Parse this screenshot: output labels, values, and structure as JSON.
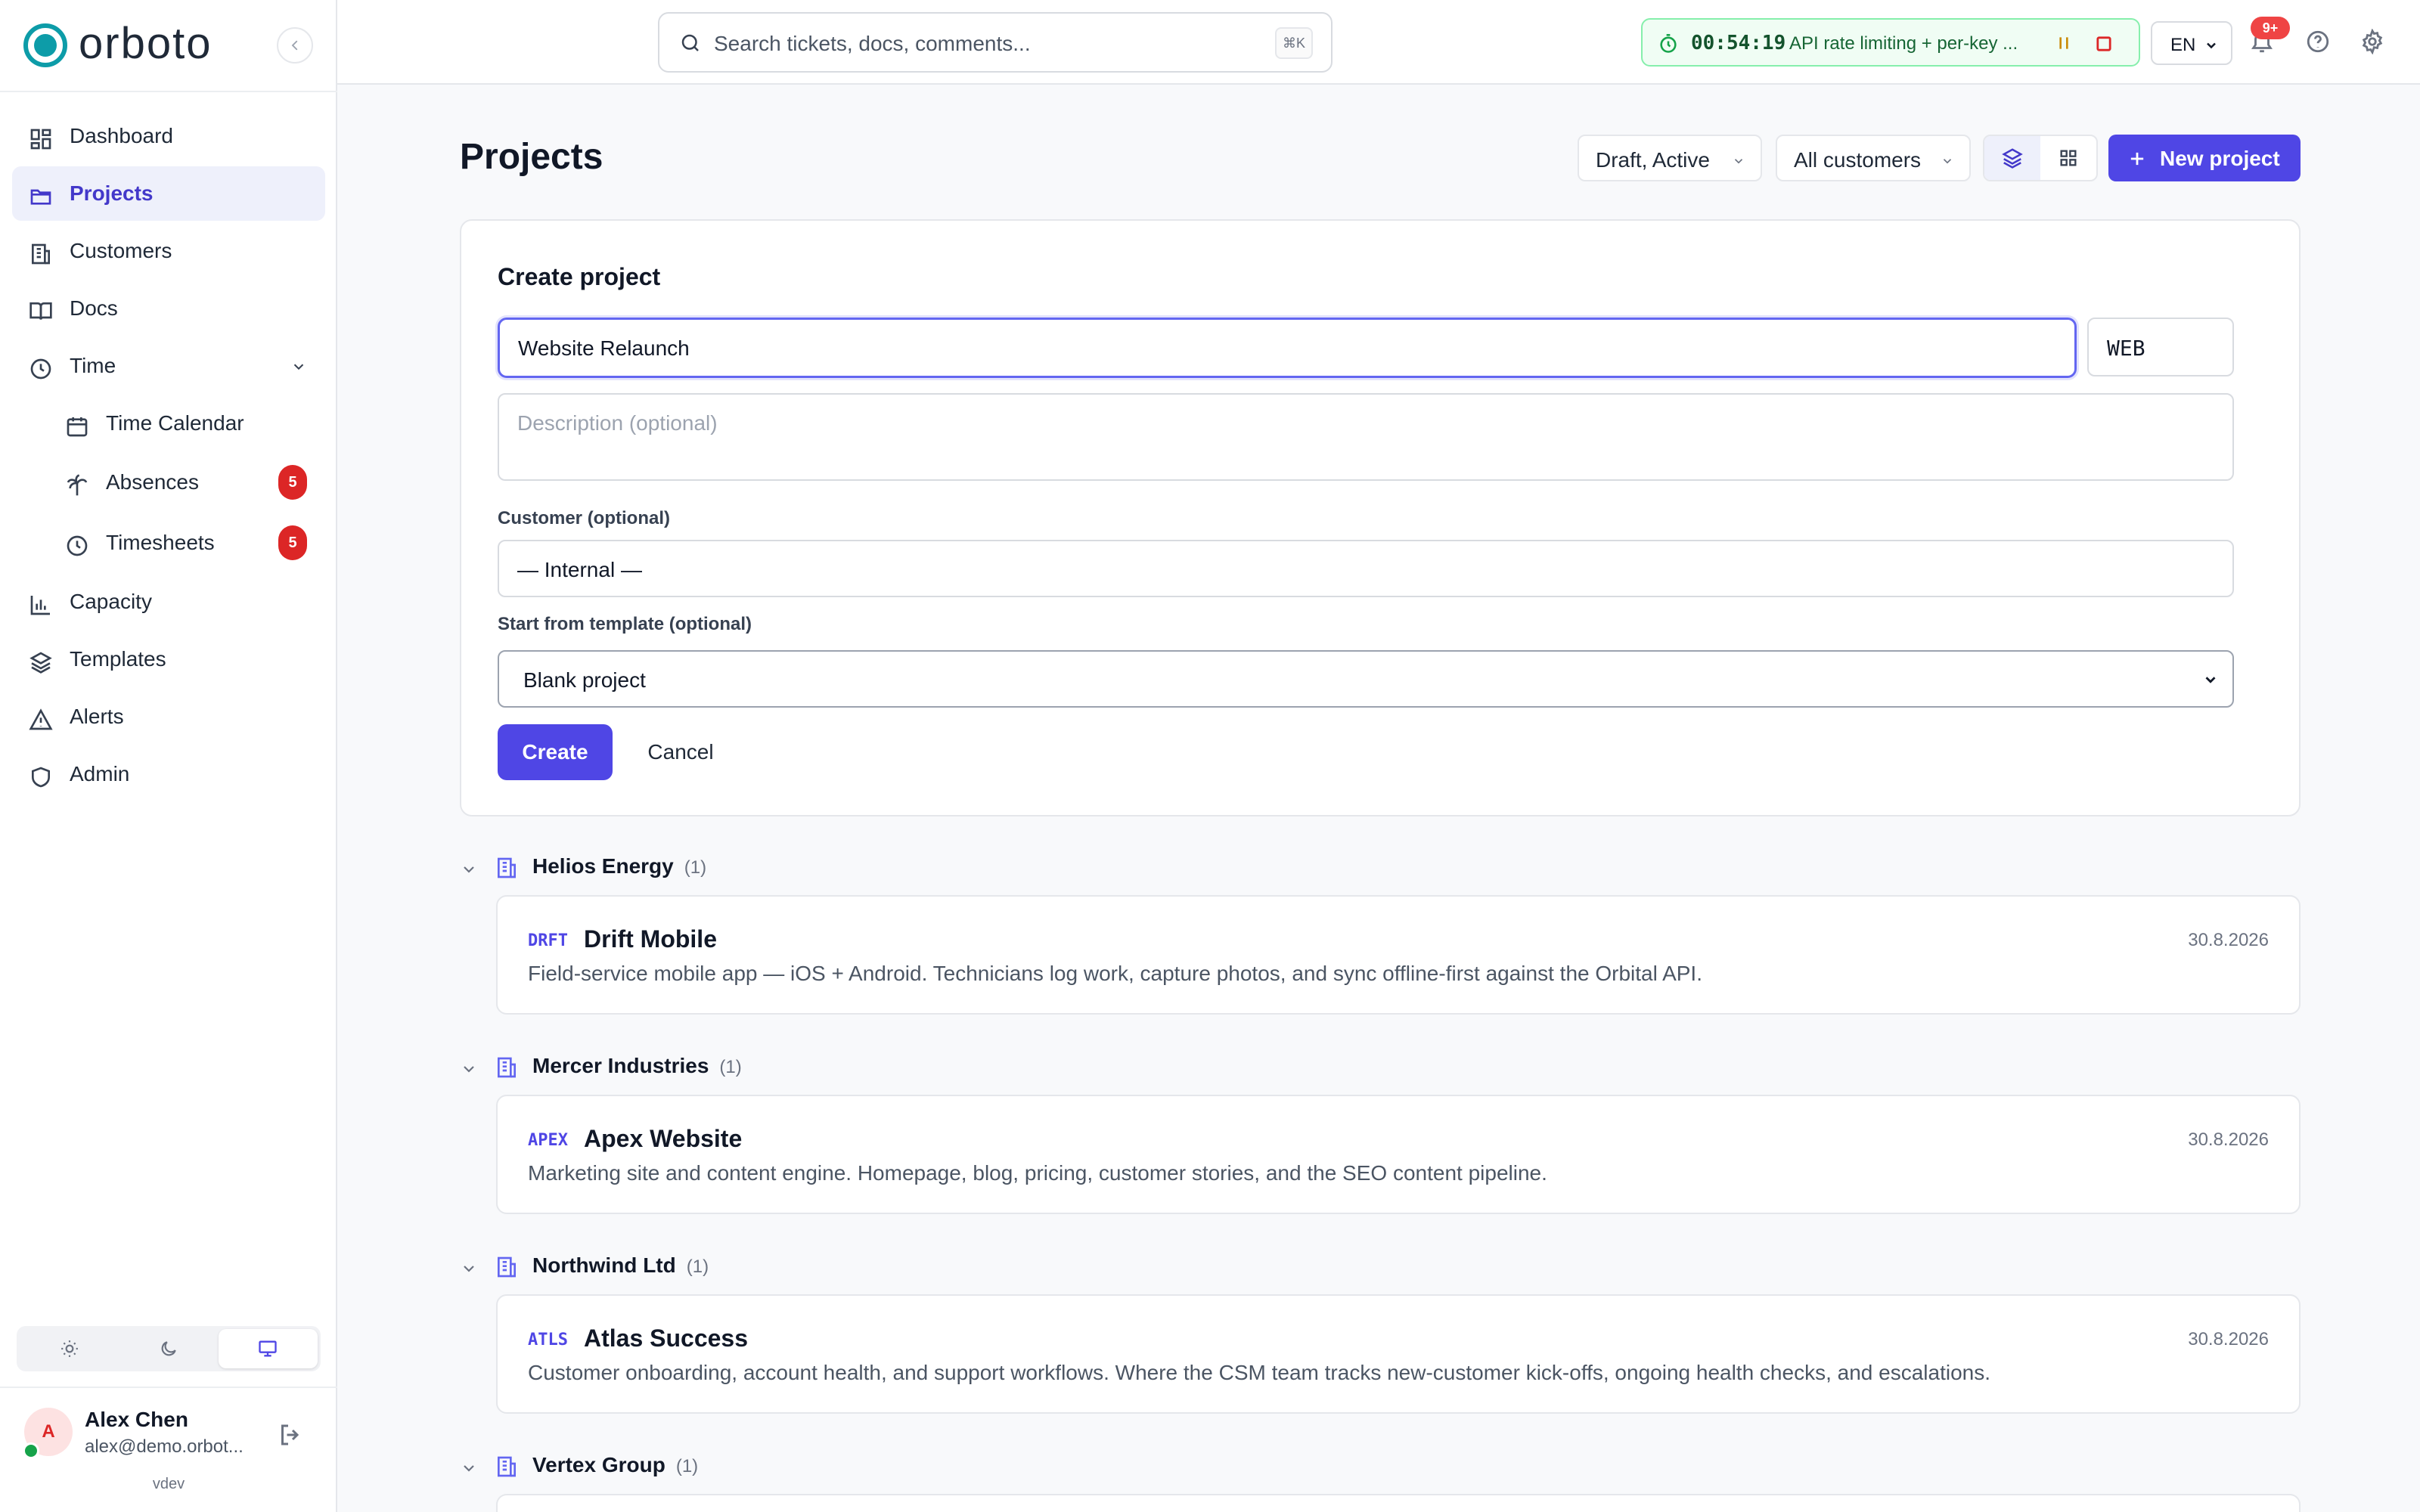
{
  "app": {
    "brand": "orboto",
    "version": "vdev"
  },
  "colors": {
    "accent": "#4f46e5",
    "brand": "#0d9ca8",
    "badge": "#dc2626",
    "timer": "#16a34a"
  },
  "sidebar": {
    "items": [
      {
        "label": "Dashboard",
        "icon": "dashboard-icon"
      },
      {
        "label": "Projects",
        "icon": "folder-icon",
        "active": true
      },
      {
        "label": "Customers",
        "icon": "building-icon"
      },
      {
        "label": "Docs",
        "icon": "book-icon"
      },
      {
        "label": "Time",
        "icon": "clock-icon",
        "expanded": true
      },
      {
        "label": "Time Calendar",
        "icon": "calendar-icon"
      },
      {
        "label": "Absences",
        "icon": "palm-tree-icon",
        "badge": "5"
      },
      {
        "label": "Timesheets",
        "icon": "clock-icon",
        "badge": "5"
      },
      {
        "label": "Capacity",
        "icon": "bar-chart-icon"
      },
      {
        "label": "Templates",
        "icon": "layers-icon"
      },
      {
        "label": "Alerts",
        "icon": "alert-triangle-icon"
      },
      {
        "label": "Admin",
        "icon": "shield-icon"
      }
    ],
    "theme": {
      "options": [
        "light",
        "dark",
        "system"
      ],
      "selected": "system"
    },
    "user": {
      "initial": "A",
      "name": "Alex Chen",
      "email": "alex@demo.orbot..."
    }
  },
  "topbar": {
    "search_placeholder": "Search tickets, docs, comments...",
    "search_shortcut": "⌘K",
    "timer": {
      "time": "00:54:19",
      "task": "API rate limiting + per-key ..."
    },
    "language": "EN",
    "notifications_badge": "9+"
  },
  "main": {
    "title": "Projects",
    "status_filter": "Draft, Active",
    "customer_filter": "All customers",
    "view_mode": "grouped",
    "new_button": "New project"
  },
  "create_form": {
    "title": "Create project",
    "name_value": "Website Relaunch",
    "key_value": "WEB",
    "description_placeholder": "Description (optional)",
    "customer_label": "Customer (optional)",
    "customer_value": "— Internal —",
    "template_label": "Start from template (optional)",
    "template_value": "Blank project",
    "create_label": "Create",
    "cancel_label": "Cancel"
  },
  "groups": [
    {
      "name": "Helios Energy",
      "count": "(1)",
      "project": {
        "key": "DRFT",
        "title": "Drift Mobile",
        "date": "30.8.2026",
        "description": "Field-service mobile app — iOS + Android. Technicians log work, capture photos, and sync offline-first against the Orbital API."
      }
    },
    {
      "name": "Mercer Industries",
      "count": "(1)",
      "project": {
        "key": "APEX",
        "title": "Apex Website",
        "date": "30.8.2026",
        "description": "Marketing site and content engine. Homepage, blog, pricing, customer stories, and the SEO content pipeline."
      }
    },
    {
      "name": "Northwind Ltd",
      "count": "(1)",
      "project": {
        "key": "ATLS",
        "title": "Atlas Success",
        "date": "30.8.2026",
        "description": "Customer onboarding, account health, and support workflows. Where the CSM team tracks new-customer kick-offs, ongoing health checks, and escalations."
      }
    },
    {
      "name": "Vertex Group",
      "count": "(1)"
    }
  ]
}
